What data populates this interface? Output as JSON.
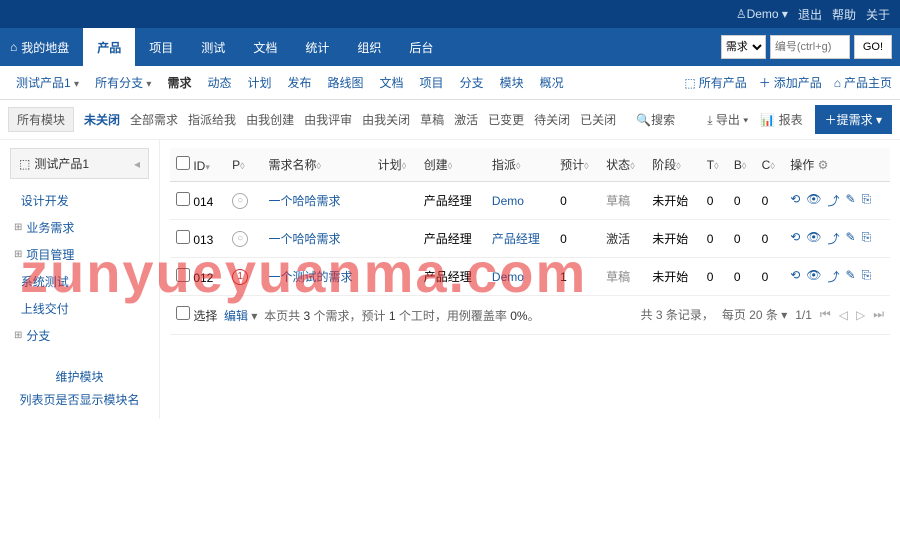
{
  "topbar": {
    "user": "Demo",
    "logout": "退出",
    "help": "帮助",
    "about": "关于"
  },
  "nav": {
    "items": [
      "我的地盘",
      "产品",
      "项目",
      "测试",
      "文档",
      "统计",
      "组织",
      "后台"
    ],
    "active_index": 1,
    "search_type": "需求",
    "search_placeholder": "编号(ctrl+g)",
    "go": "GO!"
  },
  "subnav": {
    "product": "测试产品1",
    "branch": "所有分支",
    "items": [
      "需求",
      "动态",
      "计划",
      "发布",
      "路线图",
      "文档",
      "项目",
      "分支",
      "模块",
      "概况"
    ],
    "active_index": 0,
    "right": {
      "all_products": "所有产品",
      "add_product": "添加产品",
      "home": "产品主页"
    }
  },
  "filters": {
    "all_modules": "所有模块",
    "items": [
      "未关闭",
      "全部需求",
      "指派给我",
      "由我创建",
      "由我评审",
      "由我关闭",
      "草稿",
      "激活",
      "已变更",
      "待关闭",
      "已关闭"
    ],
    "active_index": 0,
    "search_icon_label": "搜索",
    "export": "导出",
    "report": "报表",
    "create": "提需求"
  },
  "sidebar": {
    "title": "测试产品1",
    "items": [
      {
        "label": "设计开发",
        "expandable": false
      },
      {
        "label": "业务需求",
        "expandable": true
      },
      {
        "label": "项目管理",
        "expandable": true
      },
      {
        "label": "系统测试",
        "expandable": false
      },
      {
        "label": "上线交付",
        "expandable": false
      },
      {
        "label": "分支",
        "expandable": true
      }
    ],
    "maintain": "维护模块",
    "show_module": "列表页是否显示模块名"
  },
  "table": {
    "headers": {
      "id": "ID",
      "p": "P",
      "name": "需求名称",
      "plan": "计划",
      "creator": "创建",
      "assign": "指派",
      "est": "预计",
      "status": "状态",
      "stage": "阶段",
      "t": "T",
      "b": "B",
      "c": "C",
      "actions": "操作"
    },
    "rows": [
      {
        "id": "014",
        "pri": "",
        "pri_style": "g",
        "name": "一个哈哈需求",
        "plan": "",
        "creator": "产品经理",
        "assign": "Demo",
        "est": "0",
        "status": "草稿",
        "status_cls": "draft",
        "stage": "未开始",
        "t": "0",
        "b": "0",
        "c": "0"
      },
      {
        "id": "013",
        "pri": "",
        "pri_style": "g",
        "name": "一个哈哈需求",
        "plan": "",
        "creator": "产品经理",
        "assign": "产品经理",
        "est": "0",
        "status": "激活",
        "status_cls": "active",
        "stage": "未开始",
        "t": "0",
        "b": "0",
        "c": "0"
      },
      {
        "id": "012",
        "pri": "1",
        "pri_style": "c",
        "name": "一个测试的需求",
        "plan": "",
        "creator": "产品经理",
        "assign": "Demo",
        "est": "1",
        "status": "草稿",
        "status_cls": "draft",
        "stage": "未开始",
        "t": "0",
        "b": "0",
        "c": "0"
      }
    ],
    "footer": {
      "select": "选择",
      "edit": "编辑",
      "summary_prefix": "本页共",
      "summary_count": "3",
      "summary_mid": "个需求，预计",
      "summary_hours": "1",
      "summary_suffix": "个工时，用例覆盖率",
      "summary_rate": "0%",
      "total": "共 3 条记录，",
      "per_page": "每页 20 条",
      "page": "1/1"
    }
  },
  "watermark": "zunyueyuanma.com"
}
